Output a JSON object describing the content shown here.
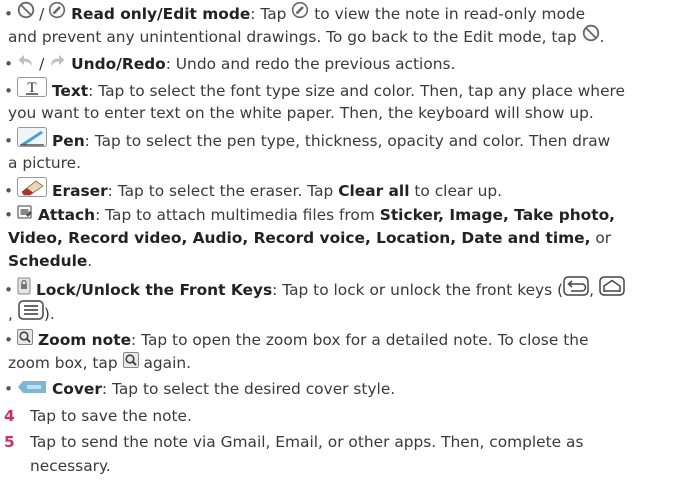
{
  "colors": {
    "accent_number": "#c8306a",
    "icon_gray": "#666666",
    "arrow_light": "#c0c0c0",
    "cover_blue": "#7fb6d6"
  },
  "items": {
    "read_only": {
      "label": "Read only/Edit mode",
      "sep": "/",
      "desc1": ": Tap",
      "desc2": "to view the note in read-only mode",
      "desc3": "and prevent any unintentional drawings. To go back to the Edit mode, tap",
      "period": "."
    },
    "undo_redo": {
      "sep": "/",
      "label": "Undo/Redo",
      "desc": ": Undo and redo the previous actions."
    },
    "text": {
      "label": "Text",
      "desc1": ": Tap to select the font type size and color. Then, tap any place where",
      "desc2": "you want to enter text on the white paper. Then, the keyboard will show up."
    },
    "pen": {
      "label": "Pen",
      "desc1": ": Tap to select the pen type, thickness, opacity and color. Then draw",
      "desc2": "a picture."
    },
    "eraser": {
      "label": "Eraser",
      "desc1": ": Tap to select the eraser. Tap",
      "clear": "Clear all",
      "desc2": "to clear up."
    },
    "attach": {
      "label": "Attach",
      "desc1": ": Tap to attach multimedia files from",
      "opts1": "Sticker, Image, Take photo,",
      "opts2": "Video, Record video, Audio, Record voice, Location, Date and time,",
      "or": "or",
      "opts3": "Schedule",
      "period": "."
    },
    "lock": {
      "label": "Lock/Unlock the Front Keys",
      "desc1": ": Tap to lock or unlock the front keys (",
      "comma1": ",",
      "comma2": ",",
      "close": ")."
    },
    "zoom": {
      "label": "Zoom note",
      "desc1": ": Tap to open the zoom box for a detailed note. To close the",
      "desc2": "zoom box, tap",
      "desc3": "again."
    },
    "cover": {
      "label": "Cover",
      "desc": ": Tap to select the desired cover style."
    }
  },
  "steps": [
    {
      "num": "4",
      "text": "Tap to save the note."
    },
    {
      "num": "5",
      "text": "Tap to send the note via Gmail, Email, or other apps. Then, complete as",
      "text2": "necessary."
    }
  ]
}
